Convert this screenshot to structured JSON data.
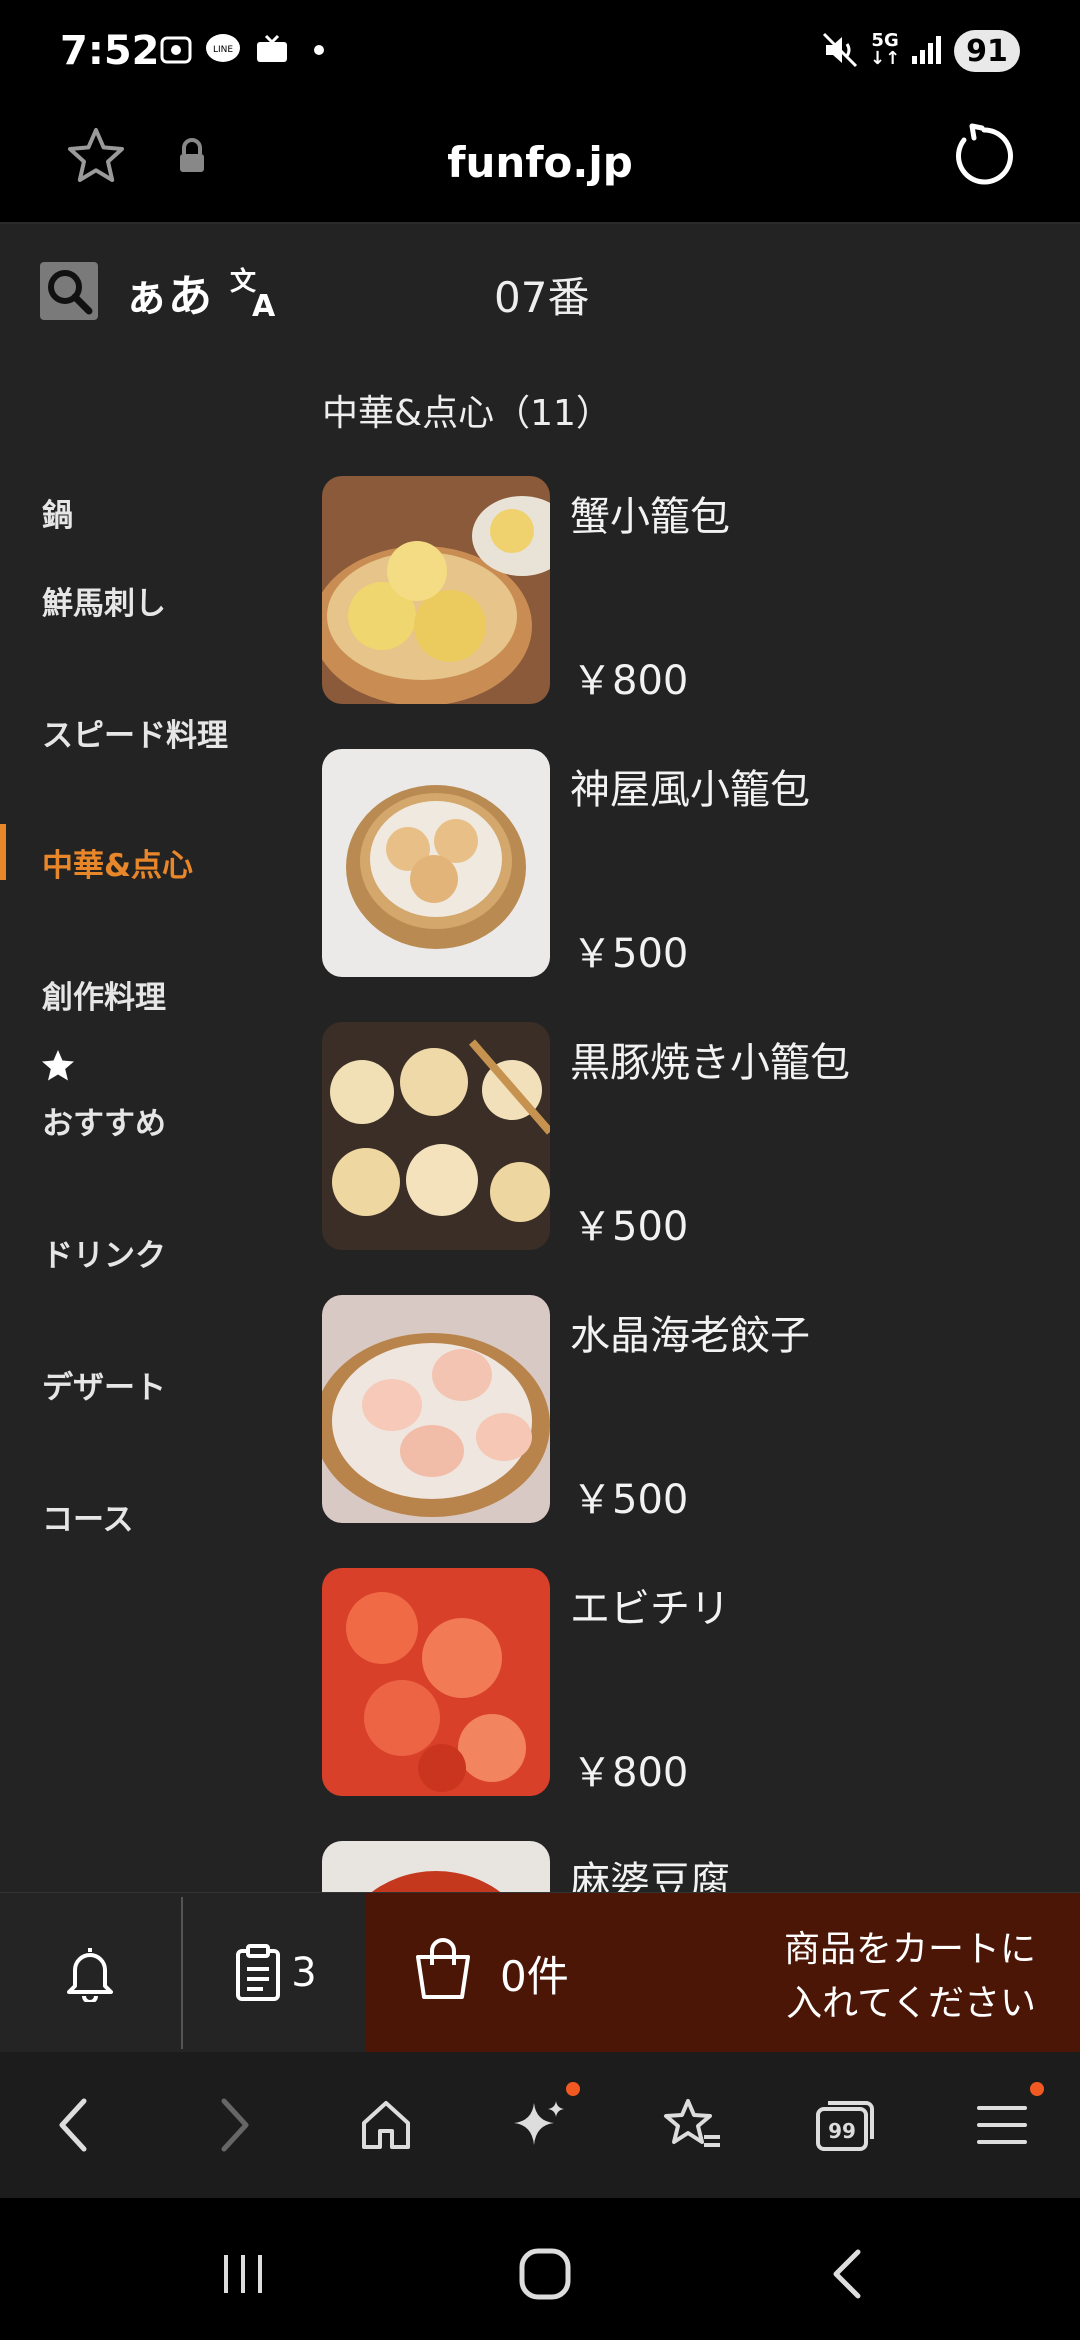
{
  "status_bar": {
    "time": "7:52",
    "network": "5G",
    "battery": "91"
  },
  "browser": {
    "url": "funfo.jp"
  },
  "menu_header": {
    "aa_label": "ぁあ",
    "table_number": "07番"
  },
  "categories": [
    {
      "label": "鍋"
    },
    {
      "label": "鮮馬刺し"
    },
    {
      "label": "スピード料理"
    },
    {
      "label": "中華&点心",
      "active": true
    },
    {
      "label": "創作料理"
    },
    {
      "label": "おすすめ",
      "icon": "star-icon"
    },
    {
      "label": "ドリンク"
    },
    {
      "label": "デザート"
    },
    {
      "label": "コース"
    }
  ],
  "section": {
    "title": "中華&点心（11）"
  },
  "items": [
    {
      "name": "蟹小籠包",
      "price": "￥800"
    },
    {
      "name": "神屋風小籠包",
      "price": "￥500"
    },
    {
      "name": "黒豚焼き小籠包",
      "price": "￥500"
    },
    {
      "name": "水晶海老餃子",
      "price": "￥500"
    },
    {
      "name": "エビチリ",
      "price": "￥800"
    },
    {
      "name": "麻婆豆腐",
      "price": ""
    }
  ],
  "order_bar": {
    "history_count": "3",
    "cart_count": "0件",
    "cart_message_line1": "商品をカートに",
    "cart_message_line2": "入れてください"
  },
  "colors": {
    "accent": "#e8862a",
    "cart_bg": "#4b1606",
    "notification_dot": "#f05a22"
  }
}
